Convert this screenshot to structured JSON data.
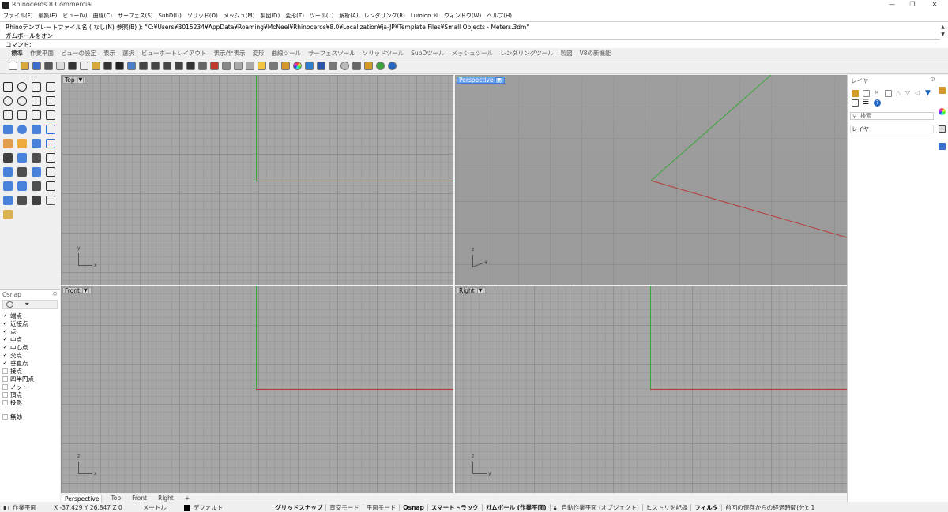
{
  "window": {
    "title": "Rhinoceros 8 Commercial",
    "minimize": "—",
    "maximize": "❐",
    "close": "✕"
  },
  "menu": [
    "ファイル(F)",
    "編集(E)",
    "ビュー(V)",
    "曲線(C)",
    "サーフェス(S)",
    "SubD(U)",
    "ソリッド(O)",
    "メッシュ(M)",
    "製図(D)",
    "変形(T)",
    "ツール(L)",
    "解析(A)",
    "レンダリング(R)",
    "Lumion ®",
    "ウィンドウ(W)",
    "ヘルプ(H)"
  ],
  "command": {
    "line1": "Rhinoテンプレートファイル名 ( なし(N)  参照(B) ): \"C:¥Users¥B015234¥AppData¥Roaming¥McNeel¥Rhinoceros¥8.0¥Localization¥ja-JP¥Template Files¥Small Objects - Meters.3dm\"",
    "line2": "ガムボールをオン",
    "prompt": "コマンド:"
  },
  "tabs": [
    "標準",
    "作業平面",
    "ビューの設定",
    "表示",
    "選択",
    "ビューポートレイアウト",
    "表示/非表示",
    "変形",
    "曲線ツール",
    "サーフェスツール",
    "ソリッドツール",
    "SubDツール",
    "メッシュツール",
    "レンダリングツール",
    "製図",
    "V8の新機能"
  ],
  "toolbar_icons": [
    "new-icon",
    "open-icon",
    "save-icon",
    "print-icon",
    "import-icon",
    "cut-icon",
    "copy-icon",
    "paste-icon",
    "undo-icon",
    "pan-icon",
    "rotate-view-icon",
    "zoom-dynamic-icon",
    "zoom-window-icon",
    "zoom-extents-icon",
    "zoom-selected-icon",
    "rotate-icon",
    "four-viewports-icon",
    "car-icon",
    "grid-icon",
    "hide-icon",
    "show-icon",
    "light-icon",
    "lock-icon",
    "layer-icon",
    "color-wheel-icon",
    "material-icon",
    "render-icon",
    "gear-icon",
    "sphere-icon",
    "gumball-icon",
    "options-icon",
    "world-icon",
    "help-icon"
  ],
  "viewports": [
    {
      "name": "Top",
      "active": false,
      "xlabel": "x",
      "ylabel": "y"
    },
    {
      "name": "Perspective",
      "active": true,
      "xlabel": "x",
      "ylabel": "y",
      "zlabel": "z"
    },
    {
      "name": "Front",
      "active": false,
      "xlabel": "x",
      "ylabel": "z"
    },
    {
      "name": "Right",
      "active": false,
      "xlabel": "y",
      "ylabel": "z"
    }
  ],
  "viewport_tabs": [
    "Perspective",
    "Top",
    "Front",
    "Right",
    "+"
  ],
  "osnap": {
    "title": "Osnap",
    "items": [
      {
        "label": "端点",
        "checked": true
      },
      {
        "label": "近接点",
        "checked": true
      },
      {
        "label": "点",
        "checked": true
      },
      {
        "label": "中点",
        "checked": true
      },
      {
        "label": "中心点",
        "checked": true
      },
      {
        "label": "交点",
        "checked": true
      },
      {
        "label": "垂直点",
        "checked": true
      },
      {
        "label": "接点",
        "checked": false
      },
      {
        "label": "四半円点",
        "checked": false
      },
      {
        "label": "ノット",
        "checked": false
      },
      {
        "label": "頂点",
        "checked": false
      },
      {
        "label": "投影",
        "checked": false
      }
    ],
    "disable": "無効"
  },
  "layers": {
    "title": "レイヤ",
    "search_placeholder": "検索",
    "column": "レイヤ"
  },
  "status": {
    "cplane": "作業平面",
    "coords": "X -37.429 Y 26.847 Z 0",
    "units": "メートル",
    "layer": "デフォルト",
    "grid_snap": "グリッドスナップ",
    "ortho": "直交モード",
    "planar": "平面モード",
    "osnap": "Osnap",
    "smarttrack": "スマートトラック",
    "gumball": "ガムボール (作業平面)",
    "autocplane": "自動作業平面 (オブジェクト)",
    "history": "ヒストリを記録",
    "filter": "フィルタ",
    "elapsed": "前回の保存からの経過時間(分): 1"
  },
  "colors": {
    "x_axis": "#b83a3a",
    "y_axis": "#3aa63a",
    "active_viewport": "#66a3ee"
  }
}
